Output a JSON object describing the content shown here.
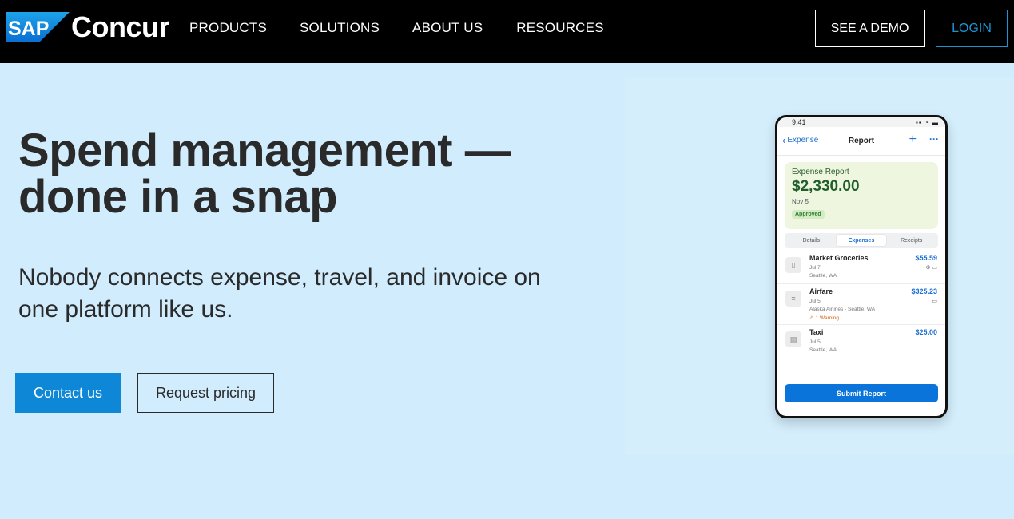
{
  "nav": {
    "logo_badge": "SAP",
    "logo_word": "Concur",
    "links": [
      "PRODUCTS",
      "SOLUTIONS",
      "ABOUT US",
      "RESOURCES"
    ],
    "demo_label": "SEE A DEMO",
    "login_label": "LOGIN"
  },
  "hero": {
    "title": "Spend management — done in a snap",
    "subtitle": "Nobody connects expense, travel, and invoice on one platform like us.",
    "contact_label": "Contact us",
    "pricing_label": "Request pricing"
  },
  "phone": {
    "time": "9:41",
    "back_label": "Expense",
    "title": "Report",
    "summary": {
      "label": "Expense Report",
      "amount": "$2,330.00",
      "date": "Nov 5",
      "status": "Approved"
    },
    "tabs": [
      "Details",
      "Expenses",
      "Receipts"
    ],
    "items": [
      {
        "name": "Market Groceries",
        "amount": "$55.59",
        "date": "Jul 7",
        "location": "Seattle, WA",
        "warning": ""
      },
      {
        "name": "Airfare",
        "amount": "$325.23",
        "date": "Jul 5",
        "location": "Alaska Airlines - Seattle, WA",
        "warning": "1 Warning"
      },
      {
        "name": "Taxi",
        "amount": "$25.00",
        "date": "Jul 5",
        "location": "Seattle, WA",
        "warning": ""
      }
    ],
    "submit_label": "Submit Report"
  },
  "colors": {
    "nav_bg": "#000000",
    "hero_bg": "#d1edfd",
    "primary_button": "#0d87d6",
    "login_accent": "#1a96d6",
    "phone_link": "#1a6fd0"
  }
}
